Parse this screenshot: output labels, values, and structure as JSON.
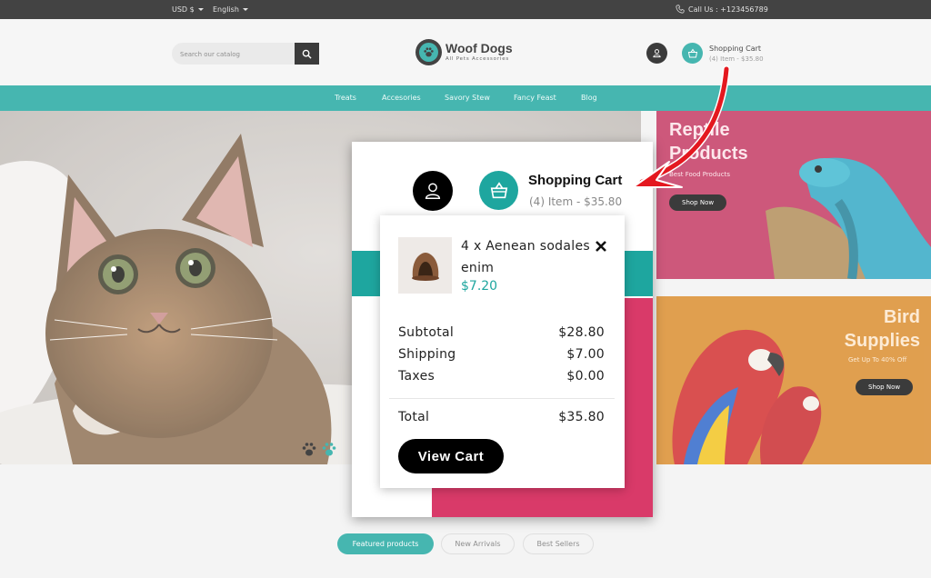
{
  "topbar": {
    "currency": "USD $",
    "language": "English",
    "contact": "Call Us : +123456789"
  },
  "header": {
    "search_placeholder": "Search our catalog",
    "logo_title": "Woof Dogs",
    "logo_subtitle": "All Pets Accessories",
    "cart_title": "Shopping Cart",
    "cart_summary": "(4) Item - $35.80"
  },
  "nav": {
    "items": [
      "Treats",
      "Accesories",
      "Savory Stew",
      "Fancy Feast",
      "Blog"
    ]
  },
  "banners": {
    "reptile": {
      "title_line1": "Reptile",
      "title_line2": "Products",
      "subtitle": "Best Food Products",
      "button": "Shop Now"
    },
    "bird": {
      "title_line1": "Bird",
      "title_line2": "Supplies",
      "subtitle": "Get Up To 40% Off",
      "button": "Shop Now"
    }
  },
  "tabs": [
    "Featured products",
    "New Arrivals",
    "Best Sellers"
  ],
  "zoom": {
    "cart_title": "Shopping Cart",
    "cart_summary": "(4) Item - $35.80"
  },
  "cart_dropdown": {
    "item_name": "4 x  Aenean sodales enim",
    "item_price": "$7.20",
    "subtotal_label": "Subtotal",
    "subtotal_value": "$28.80",
    "shipping_label": "Shipping",
    "shipping_value": "$7.00",
    "taxes_label": "Taxes",
    "taxes_value": "$0.00",
    "total_label": "Total",
    "total_value": "$35.80",
    "view_cart_label": "View Cart"
  },
  "colors": {
    "accent": "#1ea69f",
    "annotation_arrow": "#e4181f",
    "reptile_banner": "#c2345e",
    "bird_banner": "#d98a29"
  },
  "icons": [
    "caret-down-icon",
    "phone-icon",
    "search-icon",
    "paw-icon",
    "user-icon",
    "basket-icon",
    "close-icon"
  ]
}
